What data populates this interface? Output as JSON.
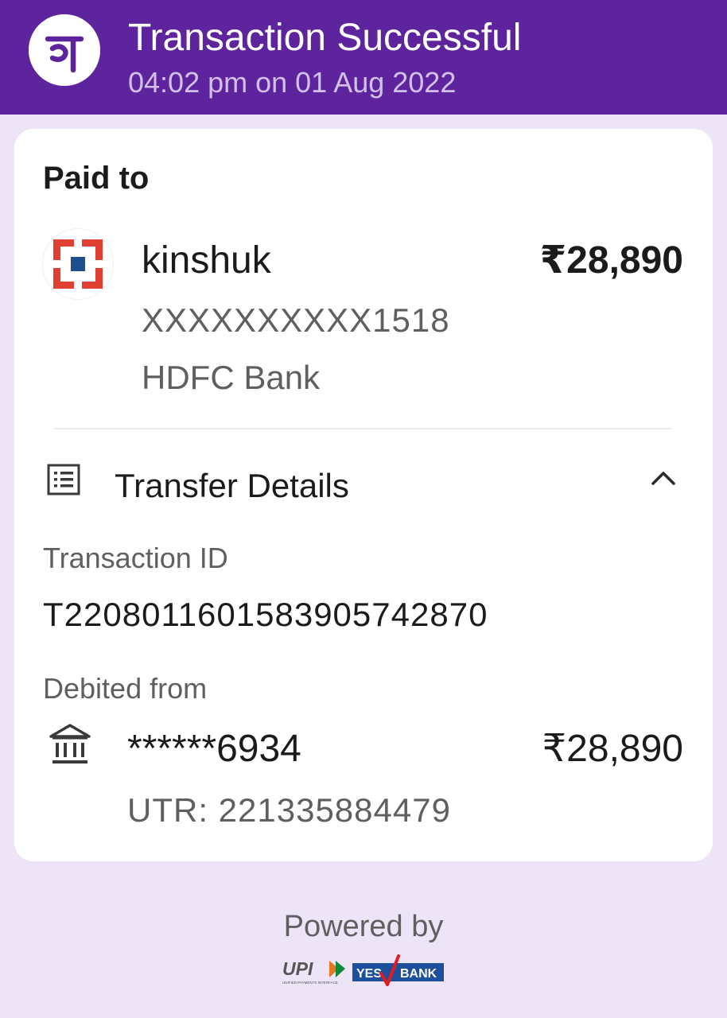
{
  "header": {
    "title": "Transaction Successful",
    "subtitle": "04:02 pm on 01 Aug 2022",
    "logo_icon": "phonepe-logo-icon",
    "logo_text": "पे",
    "bg_color": "#5E249D"
  },
  "payee": {
    "section_label": "Paid to",
    "name": "kinshuk",
    "amount": "₹28,890",
    "account": "XXXXXXXXXX1518",
    "bank": "HDFC Bank",
    "bank_icon": "hdfc-bank-logo-icon"
  },
  "transfer_details": {
    "title": "Transfer Details",
    "icon": "receipt-list-icon",
    "toggle_icon": "chevron-up-icon",
    "transaction_id_label": "Transaction ID",
    "transaction_id": "T2208011601583905742870",
    "debited_from_label": "Debited from",
    "debit_account": "******6934",
    "debit_amount": "₹28,890",
    "utr": "UTR: 221335884479",
    "bank_icon": "bank-building-icon"
  },
  "footer": {
    "powered_by": "Powered by",
    "upi_logo_text": "UPI",
    "upi_tagline": "UNIFIED PAYMENTS INTERFACE",
    "partner_logo_text_1": "YES",
    "partner_logo_text_2": "BANK"
  },
  "colors": {
    "brand_purple": "#5E249D",
    "page_bg": "#EEE4F7",
    "hdfc_red": "#E23F33",
    "hdfc_blue": "#1F4E8C",
    "yes_blue": "#1C4F9C"
  }
}
